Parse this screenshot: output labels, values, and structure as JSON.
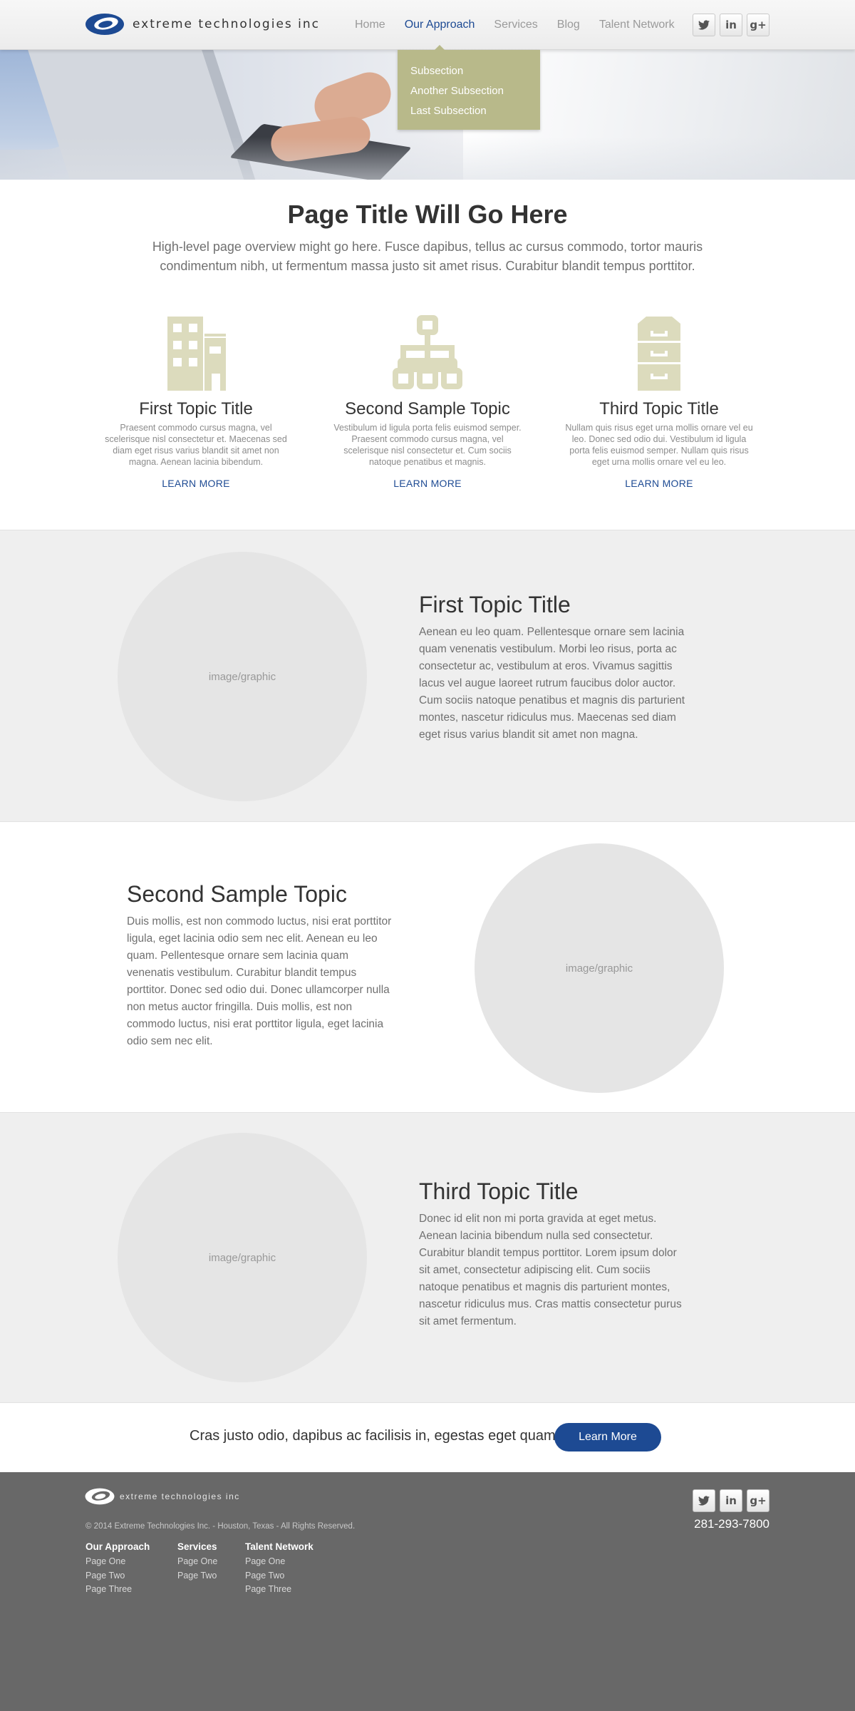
{
  "header": {
    "brand": "extreme technologies inc",
    "nav": [
      "Home",
      "Our Approach",
      "Services",
      "Blog",
      "Talent Network"
    ],
    "active_nav": "Our Approach",
    "dropdown": [
      "Subsection",
      "Another Subsection",
      "Last Subsection"
    ],
    "social": [
      {
        "icon": "twitter-icon",
        "glyph": "🐦"
      },
      {
        "icon": "linkedin-icon",
        "glyph": "in"
      },
      {
        "icon": "google-plus-icon",
        "glyph": "g+"
      }
    ]
  },
  "intro": {
    "title": "Page Title Will Go Here",
    "text": "High-level page overview might go here. Fusce dapibus, tellus ac cursus commodo, tortor mauris condimentum nibh, ut fermentum massa justo sit amet risus. Curabitur blandit tempus porttitor."
  },
  "topics": [
    {
      "icon": "building-icon",
      "title": "First Topic Title",
      "text": "Praesent commodo cursus magna, vel scelerisque nisl consectetur et. Maecenas sed diam eget risus varius blandit sit amet non magna. Aenean lacinia bibendum.",
      "link": "LEARN MORE"
    },
    {
      "icon": "org-chart-icon",
      "title": "Second Sample Topic",
      "text": "Vestibulum id ligula porta felis euismod semper. Praesent commodo cursus magna, vel scelerisque nisl consectetur et. Cum sociis natoque penatibus et magnis.",
      "link": "LEARN MORE"
    },
    {
      "icon": "file-cabinet-icon",
      "title": "Third Topic Title",
      "text": "Nullam quis risus eget urna mollis ornare vel eu leo. Donec sed odio dui. Vestibulum id ligula porta felis euismod semper. Nullam quis risus eget urna mollis ornare vel eu leo.",
      "link": "LEARN MORE"
    }
  ],
  "features": [
    {
      "placeholder": "image/graphic",
      "title": "First Topic Title",
      "text": "Aenean eu leo quam. Pellentesque ornare sem lacinia quam venenatis vestibulum. Morbi leo risus, porta ac consectetur ac, vestibulum at eros. Vivamus sagittis lacus vel augue laoreet rutrum faucibus dolor auctor. Cum sociis natoque penatibus et magnis dis parturient montes, nascetur ridiculus mus. Maecenas sed diam eget risus varius blandit sit amet non magna."
    },
    {
      "placeholder": "image/graphic",
      "title": "Second Sample Topic",
      "text": "Duis mollis, est non commodo luctus, nisi erat porttitor ligula, eget lacinia odio sem nec elit. Aenean eu leo quam. Pellentesque ornare sem lacinia quam venenatis vestibulum. Curabitur blandit tempus porttitor. Donec sed odio dui. Donec ullamcorper nulla non metus auctor fringilla. Duis mollis, est non commodo luctus, nisi erat porttitor ligula, eget lacinia odio sem nec elit."
    },
    {
      "placeholder": "image/graphic",
      "title": "Third Topic Title",
      "text": "Donec id elit non mi porta gravida at eget metus. Aenean lacinia bibendum nulla sed consectetur. Curabitur blandit tempus porttitor. Lorem ipsum dolor sit amet, consectetur adipiscing elit. Cum sociis natoque penatibus et magnis dis parturient montes, nascetur ridiculus mus. Cras mattis consectetur purus sit amet fermentum."
    }
  ],
  "cta": {
    "text": "Cras justo odio, dapibus ac facilisis in, egestas eget quam.",
    "button": "Learn More"
  },
  "footer": {
    "brand": "extreme technologies inc",
    "copyright": "© 2014 Extreme Technologies Inc. - Houston, Texas - All Rights Reserved.",
    "phone": "281-293-7800",
    "columns": [
      {
        "title": "Our Approach",
        "links": [
          "Page One",
          "Page Two",
          "Page Three"
        ]
      },
      {
        "title": "Services",
        "links": [
          "Page One",
          "Page Two"
        ]
      },
      {
        "title": "Talent Network",
        "links": [
          "Page One",
          "Page Two",
          "Page Three"
        ]
      }
    ]
  },
  "colors": {
    "accent": "#1d4a93",
    "dropdown_bg": "#b8b98a",
    "icon_tan": "#dcdbbd",
    "band_grey": "#efefef",
    "footer_bg": "#686868"
  }
}
